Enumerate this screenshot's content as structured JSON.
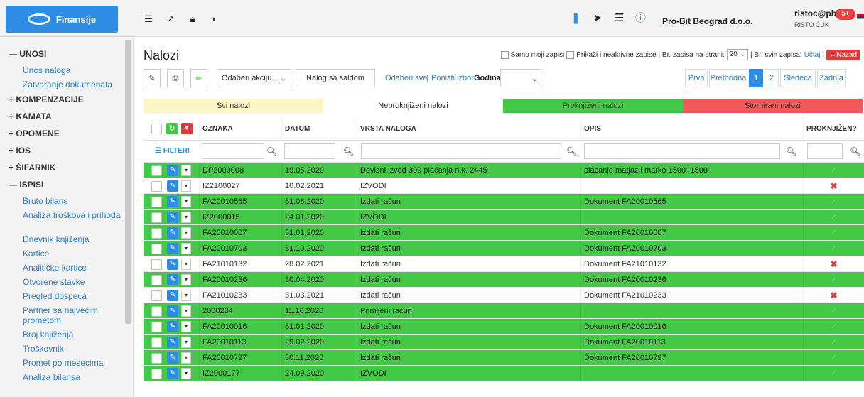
{
  "app": {
    "brand": "Finansije",
    "company": "Pro-Bit Beograd d.o.o.",
    "user_name": "ristoc@pbbg",
    "user_full": "RISTO ĆUK",
    "notif_badge": "5+",
    "accent_color": "#2d8ce5"
  },
  "sidebar": {
    "sections": [
      {
        "label": "UNOSI",
        "expanded": true,
        "items": [
          "Unos naloga",
          "Zatvaranje dokumenata"
        ]
      },
      {
        "label": "KOMPENZACIJE",
        "expanded": false,
        "items": []
      },
      {
        "label": "KAMATA",
        "expanded": false,
        "items": []
      },
      {
        "label": "OPOMENE",
        "expanded": false,
        "items": []
      },
      {
        "label": "IOS",
        "expanded": false,
        "items": []
      },
      {
        "label": "ŠIFARNIK",
        "expanded": false,
        "items": []
      },
      {
        "label": "ISPISI",
        "expanded": true,
        "items": [
          "Bruto bilans",
          "Analiza troškova i prihoda",
          "Dnevnik knjiženja",
          "Kartice",
          "Analitičke kartice",
          "Otvorene stavke",
          "Pregled dospeća",
          "Partner sa najvećim prometom",
          "Broj knjiženja",
          "Troškovnik",
          "Promet po mesecima",
          "Analiza bilansa"
        ]
      }
    ]
  },
  "page": {
    "title": "Nalozi",
    "only_mine": "Samo moji zapisi",
    "show_inactive": "Prikaži i neaktivne zapise",
    "per_page_label": "| Br. zapisa na strani:",
    "per_page_value": "20",
    "total_label": "| Br. svih zapisa:",
    "total_link": "Učtaj",
    "back_button": "Nazad"
  },
  "toolbar": {
    "action_select": "Odaberi akciju...",
    "nalog_saldo": "Nalog sa saldom",
    "select_all": "Odaberi sve",
    "clear_selection": "Poništi izbor",
    "year_label": "Godina",
    "pager_first": "Prva",
    "pager_prev": "Prethodna",
    "pager_page1": "1",
    "pager_page2": "2",
    "pager_next": "Sledeća",
    "pager_last": "Zadnja"
  },
  "status_tabs": [
    {
      "label": "Svi nalozi",
      "color": "#fdf5c4"
    },
    {
      "label": "Neproknjiženi nalozi",
      "color": "#ffffff"
    },
    {
      "label": "Proknjiženi nalozi",
      "color": "#44c946"
    },
    {
      "label": "Stornirani nalozi",
      "color": "#f25a5a"
    }
  ],
  "grid": {
    "columns": [
      "OZNAKA",
      "DATUM",
      "VRSTA NALOGA",
      "OPIS",
      "PROKNJIŽEN?"
    ],
    "filter_label": "FILTERI",
    "rows": [
      {
        "oznaka": "DP2000008",
        "datum": "19.05.2020",
        "vrsta": "Devizni izvod 309 plaćanja n.k. 2445",
        "opis": "placanje matjaz i marko 1500+1500",
        "posted": true
      },
      {
        "oznaka": "IZ2100027",
        "datum": "10.02.2021",
        "vrsta": "IZVODI",
        "opis": "",
        "posted": false
      },
      {
        "oznaka": "FA20010565",
        "datum": "31.08.2020",
        "vrsta": "Izdati račun",
        "opis": "Dokument FA20010565",
        "posted": true
      },
      {
        "oznaka": "IZ2000015",
        "datum": "24.01.2020",
        "vrsta": "IZVODI",
        "opis": "",
        "posted": true
      },
      {
        "oznaka": "FA20010007",
        "datum": "31.01.2020",
        "vrsta": "Izdati račun",
        "opis": "Dokument FA20010007",
        "posted": true
      },
      {
        "oznaka": "FA20010703",
        "datum": "31.10.2020",
        "vrsta": "Izdati račun",
        "opis": "Dokument FA20010703",
        "posted": true
      },
      {
        "oznaka": "FA21010132",
        "datum": "28.02.2021",
        "vrsta": "Izdati račun",
        "opis": "Dokument FA21010132",
        "posted": false
      },
      {
        "oznaka": "FA20010236",
        "datum": "30.04.2020",
        "vrsta": "Izdati račun",
        "opis": "Dokument FA20010236",
        "posted": true
      },
      {
        "oznaka": "FA21010233",
        "datum": "31.03.2021",
        "vrsta": "Izdati račun",
        "opis": "Dokument FA21010233",
        "posted": false
      },
      {
        "oznaka": "2000234",
        "datum": "11.10.2020",
        "vrsta": "Primljeni račun",
        "opis": "",
        "posted": true
      },
      {
        "oznaka": "FA20010016",
        "datum": "31.01.2020",
        "vrsta": "Izdati račun",
        "opis": "Dokument FA20010016",
        "posted": true
      },
      {
        "oznaka": "FA20010113",
        "datum": "29.02.2020",
        "vrsta": "Izdati račun",
        "opis": "Dokument FA20010113",
        "posted": true
      },
      {
        "oznaka": "FA20010797",
        "datum": "30.11.2020",
        "vrsta": "Izdati račun",
        "opis": "Dokument FA20010797",
        "posted": true
      },
      {
        "oznaka": "IZ2000177",
        "datum": "24.09.2020",
        "vrsta": "IZVODI",
        "opis": "",
        "posted": true
      }
    ]
  }
}
